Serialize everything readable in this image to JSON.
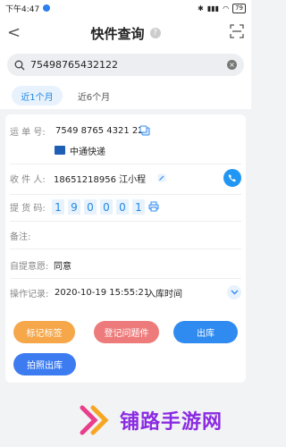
{
  "status": {
    "time": "下午4:47",
    "battery": "79"
  },
  "header": {
    "back": "<",
    "title": "快件查询",
    "help": "?"
  },
  "search": {
    "value": "75498765432122",
    "clear": "×"
  },
  "tabs": [
    {
      "label": "近1个月"
    },
    {
      "label": "近6个月"
    }
  ],
  "detail": {
    "waybill_label": "运 单 号:",
    "waybill_value": "7549  8765  4321  22",
    "carrier": "中通快递",
    "recipient_label": "收 件 人:",
    "recipient_value": "18651218956  江小程",
    "pickup_label": "提 货 码:",
    "pickup_digits": [
      "1",
      "9",
      "0",
      "0",
      "0",
      "1"
    ],
    "note_label": "备注:",
    "self_pickup_label": "自提意愿:",
    "self_pickup_value": "同意",
    "log_label": "操作记录:",
    "log_time": "2020-10-19 15:55:21",
    "log_event": "入库时间"
  },
  "buttons": {
    "tag": "标记标签",
    "issue": "登记问题件",
    "outbound": "出库",
    "photo_outbound": "拍照出库"
  },
  "watermark": {
    "text": "铺路手游网"
  },
  "colors": {
    "accent": "#2f8bf0",
    "orange": "#f5a74a",
    "red": "#ee7b7b"
  }
}
